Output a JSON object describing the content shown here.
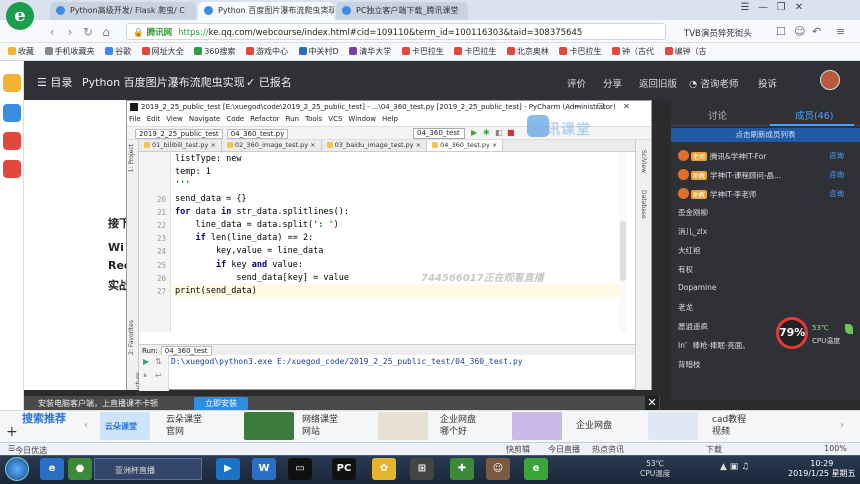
{
  "browser": {
    "tabs": [
      {
        "label": "Python高级开发/ Flask 爬虫/ C"
      },
      {
        "label": "Python 百度图片瀑布流爬虫实现"
      },
      {
        "label": "PC独立客户端下载_腾讯课堂"
      }
    ],
    "logo": "e",
    "url_proto": "https://",
    "url_rest": "ke.qq.com/webcourse/index.html#cid=109110&term_id=100116303&taid=308375645",
    "site_label": "腾讯网",
    "right_text": "TVB演员猝死街头",
    "bookmarks": [
      "收藏",
      "手机收藏夹",
      "谷歌",
      "网址大全",
      "360搜索",
      "游戏中心",
      "中关村D",
      "清华大学",
      "卡巴拉生",
      "卡巴拉生",
      "北京奥林",
      "卡巴拉生",
      "钟（古代",
      "编钟（古"
    ],
    "win_controls": [
      "☰",
      "—",
      "❐",
      "✕"
    ]
  },
  "site": {
    "menu": "☰ 目录",
    "course_title": "Python 百度图片瀑布流爬虫实现",
    "signed": "✓ 已报名",
    "nav": [
      "评价",
      "分享",
      "返回旧版",
      "咨询老师",
      "投诉"
    ]
  },
  "page_fragments": [
    "接下",
    "Wi",
    "Rec",
    "实战"
  ],
  "pycharm": {
    "title": "2019_2_25_public_test [E:\\xuegod\\code\\2019_2_25_public_test] - ...\\04_360_test.py [2019_2_25_public_test] - PyCharm (Administrator)",
    "menu": [
      "File",
      "Edit",
      "View",
      "Navigate",
      "Code",
      "Refactor",
      "Run",
      "Tools",
      "VCS",
      "Window",
      "Help"
    ],
    "breadcrumbs": [
      "2019_2_25_public_test",
      "04_360_test.py"
    ],
    "run_config": "04_360_test",
    "watermark": "腾讯课堂",
    "editor_tabs": [
      "01_bilibili_test.py",
      "02_360_image_test.py",
      "03_baidu_image_test.py",
      "04_360_test.py"
    ],
    "left_tools": [
      "1: Project",
      "2: Favorites",
      "7: Structure"
    ],
    "right_tools": [
      "SciView",
      "Database"
    ],
    "line_numbers": [
      "",
      "",
      "",
      "20",
      "21",
      "22",
      "23",
      "24",
      "25",
      "26",
      "27",
      ""
    ],
    "code": [
      "listType: new",
      "temp: 1",
      "'''",
      "send_data = {}",
      "for data in str_data.splitlines():",
      "    line_data = data.split(': ')",
      "    if len(line_data) == 2:",
      "        key,value = line_data",
      "        if key and value:",
      "            send_data[key] = value",
      "print(send_data)",
      ""
    ],
    "remote_watermark": "744566017正在观看直播",
    "run_label": "Run:",
    "run_tab": "04_360_test",
    "run_output": "D:\\xuegod\\python3.exe E:/xuegod_code/2019_2_25_public_test/04_360_test.py"
  },
  "right_panel": {
    "tab_discuss": "讨论",
    "tab_members": "成员(46)",
    "refresh": "点击刷新成员列表",
    "members": [
      {
        "badge": "老师",
        "name": "腾讯&学神IT-For",
        "ask": "咨询"
      },
      {
        "badge": "助教",
        "name": "学神IT-课程顾问-晶...",
        "ask": "咨询"
      },
      {
        "badge": "助教",
        "name": "学神IT-李老师",
        "ask": "咨询"
      },
      {
        "badge": "",
        "name": "歪金刚柳",
        "ask": ""
      },
      {
        "badge": "",
        "name": "消儿_zlx",
        "ask": ""
      },
      {
        "badge": "",
        "name": "大红袍",
        "ask": ""
      },
      {
        "badge": "",
        "name": "有权",
        "ask": ""
      },
      {
        "badge": "",
        "name": "Dopamine",
        "ask": ""
      },
      {
        "badge": "",
        "name": "老龙",
        "ask": ""
      },
      {
        "badge": "",
        "name": "愿逍遥疯",
        "ask": ""
      },
      {
        "badge": "",
        "name": "In゛棒枪·棒眠·亮面。",
        "ask": ""
      },
      {
        "badge": "",
        "name": "背暗枝",
        "ask": ""
      }
    ],
    "cpu_percent": "79%",
    "cpu_temp": "53℃",
    "cpu_label": "CPU温度"
  },
  "install": {
    "text": "安装电脑客户端，上直播课不卡顿",
    "button": "立即安装"
  },
  "ads": {
    "search_rec": "搜索推荐",
    "items": [
      {
        "title": "云朵课堂",
        "sub": "官网"
      },
      {
        "title": "网络课堂",
        "sub": "网站"
      },
      {
        "title": "企业网盘",
        "sub": "哪个好"
      },
      {
        "title": "企业网盘",
        "sub": ""
      },
      {
        "title": "cad教程",
        "sub": "视频"
      }
    ],
    "cloud_label": "云朵课堂"
  },
  "statusbar": {
    "left": "今日优选",
    "right": [
      "快剪辑",
      "今日直播",
      "热点资讯",
      "下载",
      "100%"
    ]
  },
  "taskbar": {
    "window_label": "亚洲杯直播",
    "tray_temp": "53℃",
    "tray_label": "CPU温度",
    "time": "10:29",
    "date": "2019/1/25 星期五"
  }
}
